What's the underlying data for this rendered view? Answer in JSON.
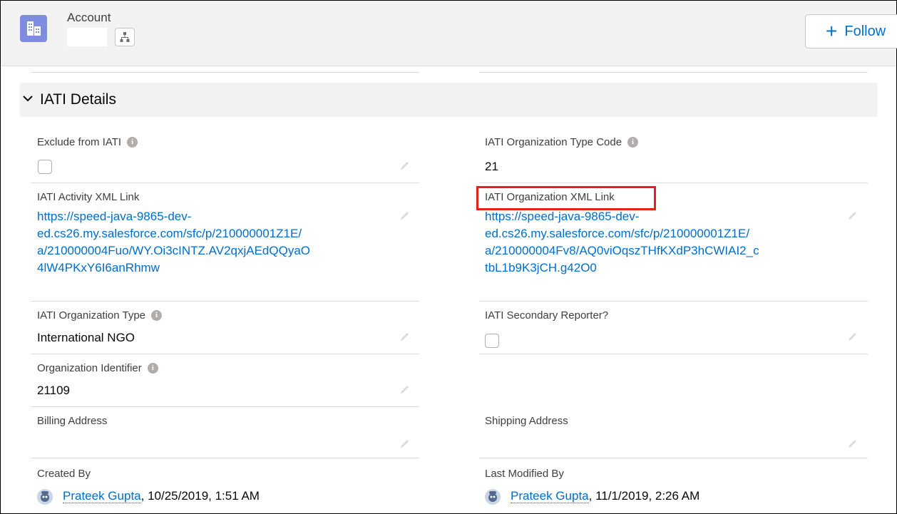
{
  "header": {
    "object_label": "Account",
    "follow_label": "Follow"
  },
  "section": {
    "title": "IATI Details"
  },
  "fields": {
    "exclude_from_iati": {
      "label": "Exclude from IATI",
      "checked": false
    },
    "org_type_code": {
      "label": "IATI Organization Type Code",
      "value": "21"
    },
    "activity_xml_link": {
      "label": "IATI Activity XML Link",
      "lines": [
        "https://speed-java-9865-dev-",
        "ed.cs26.my.salesforce.com/sfc/p/210000001Z1E/",
        "a/210000004Fuo/WY.Oi3cINTZ.AV2qxjAEdQQyaO",
        "4lW4PKxY6I6anRhmw"
      ]
    },
    "org_xml_link": {
      "label": "IATI Organization XML Link",
      "lines": [
        "https://speed-java-9865-dev-",
        "ed.cs26.my.salesforce.com/sfc/p/210000001Z1E/",
        "a/210000004Fv8/AQ0viOqszTHfKXdP3hCWIAI2_c",
        "tbL1b9K3jCH.g42O0"
      ]
    },
    "org_type": {
      "label": "IATI Organization Type",
      "value": "International NGO"
    },
    "secondary_reporter": {
      "label": "IATI Secondary Reporter?",
      "checked": false
    },
    "org_identifier": {
      "label": "Organization Identifier",
      "value": "21109"
    },
    "billing_address": {
      "label": "Billing Address",
      "value": ""
    },
    "shipping_address": {
      "label": "Shipping Address",
      "value": ""
    },
    "created_by": {
      "label": "Created By",
      "user": "Prateek Gupta",
      "date": ", 10/25/2019, 1:51 AM"
    },
    "last_modified_by": {
      "label": "Last Modified By",
      "user": "Prateek Gupta",
      "date": ", 11/1/2019, 2:26 AM"
    }
  },
  "icons": {
    "object": "account-building-icon",
    "hierarchy": "hierarchy-icon",
    "follow": "plus-icon",
    "section_toggle": "chevron-down-icon",
    "info": "info-icon",
    "edit": "pencil-icon",
    "avatar": "user-avatar-icon"
  },
  "colors": {
    "link": "#006dcc",
    "object_icon": "#7f8de1",
    "highlight": "#e32119"
  }
}
